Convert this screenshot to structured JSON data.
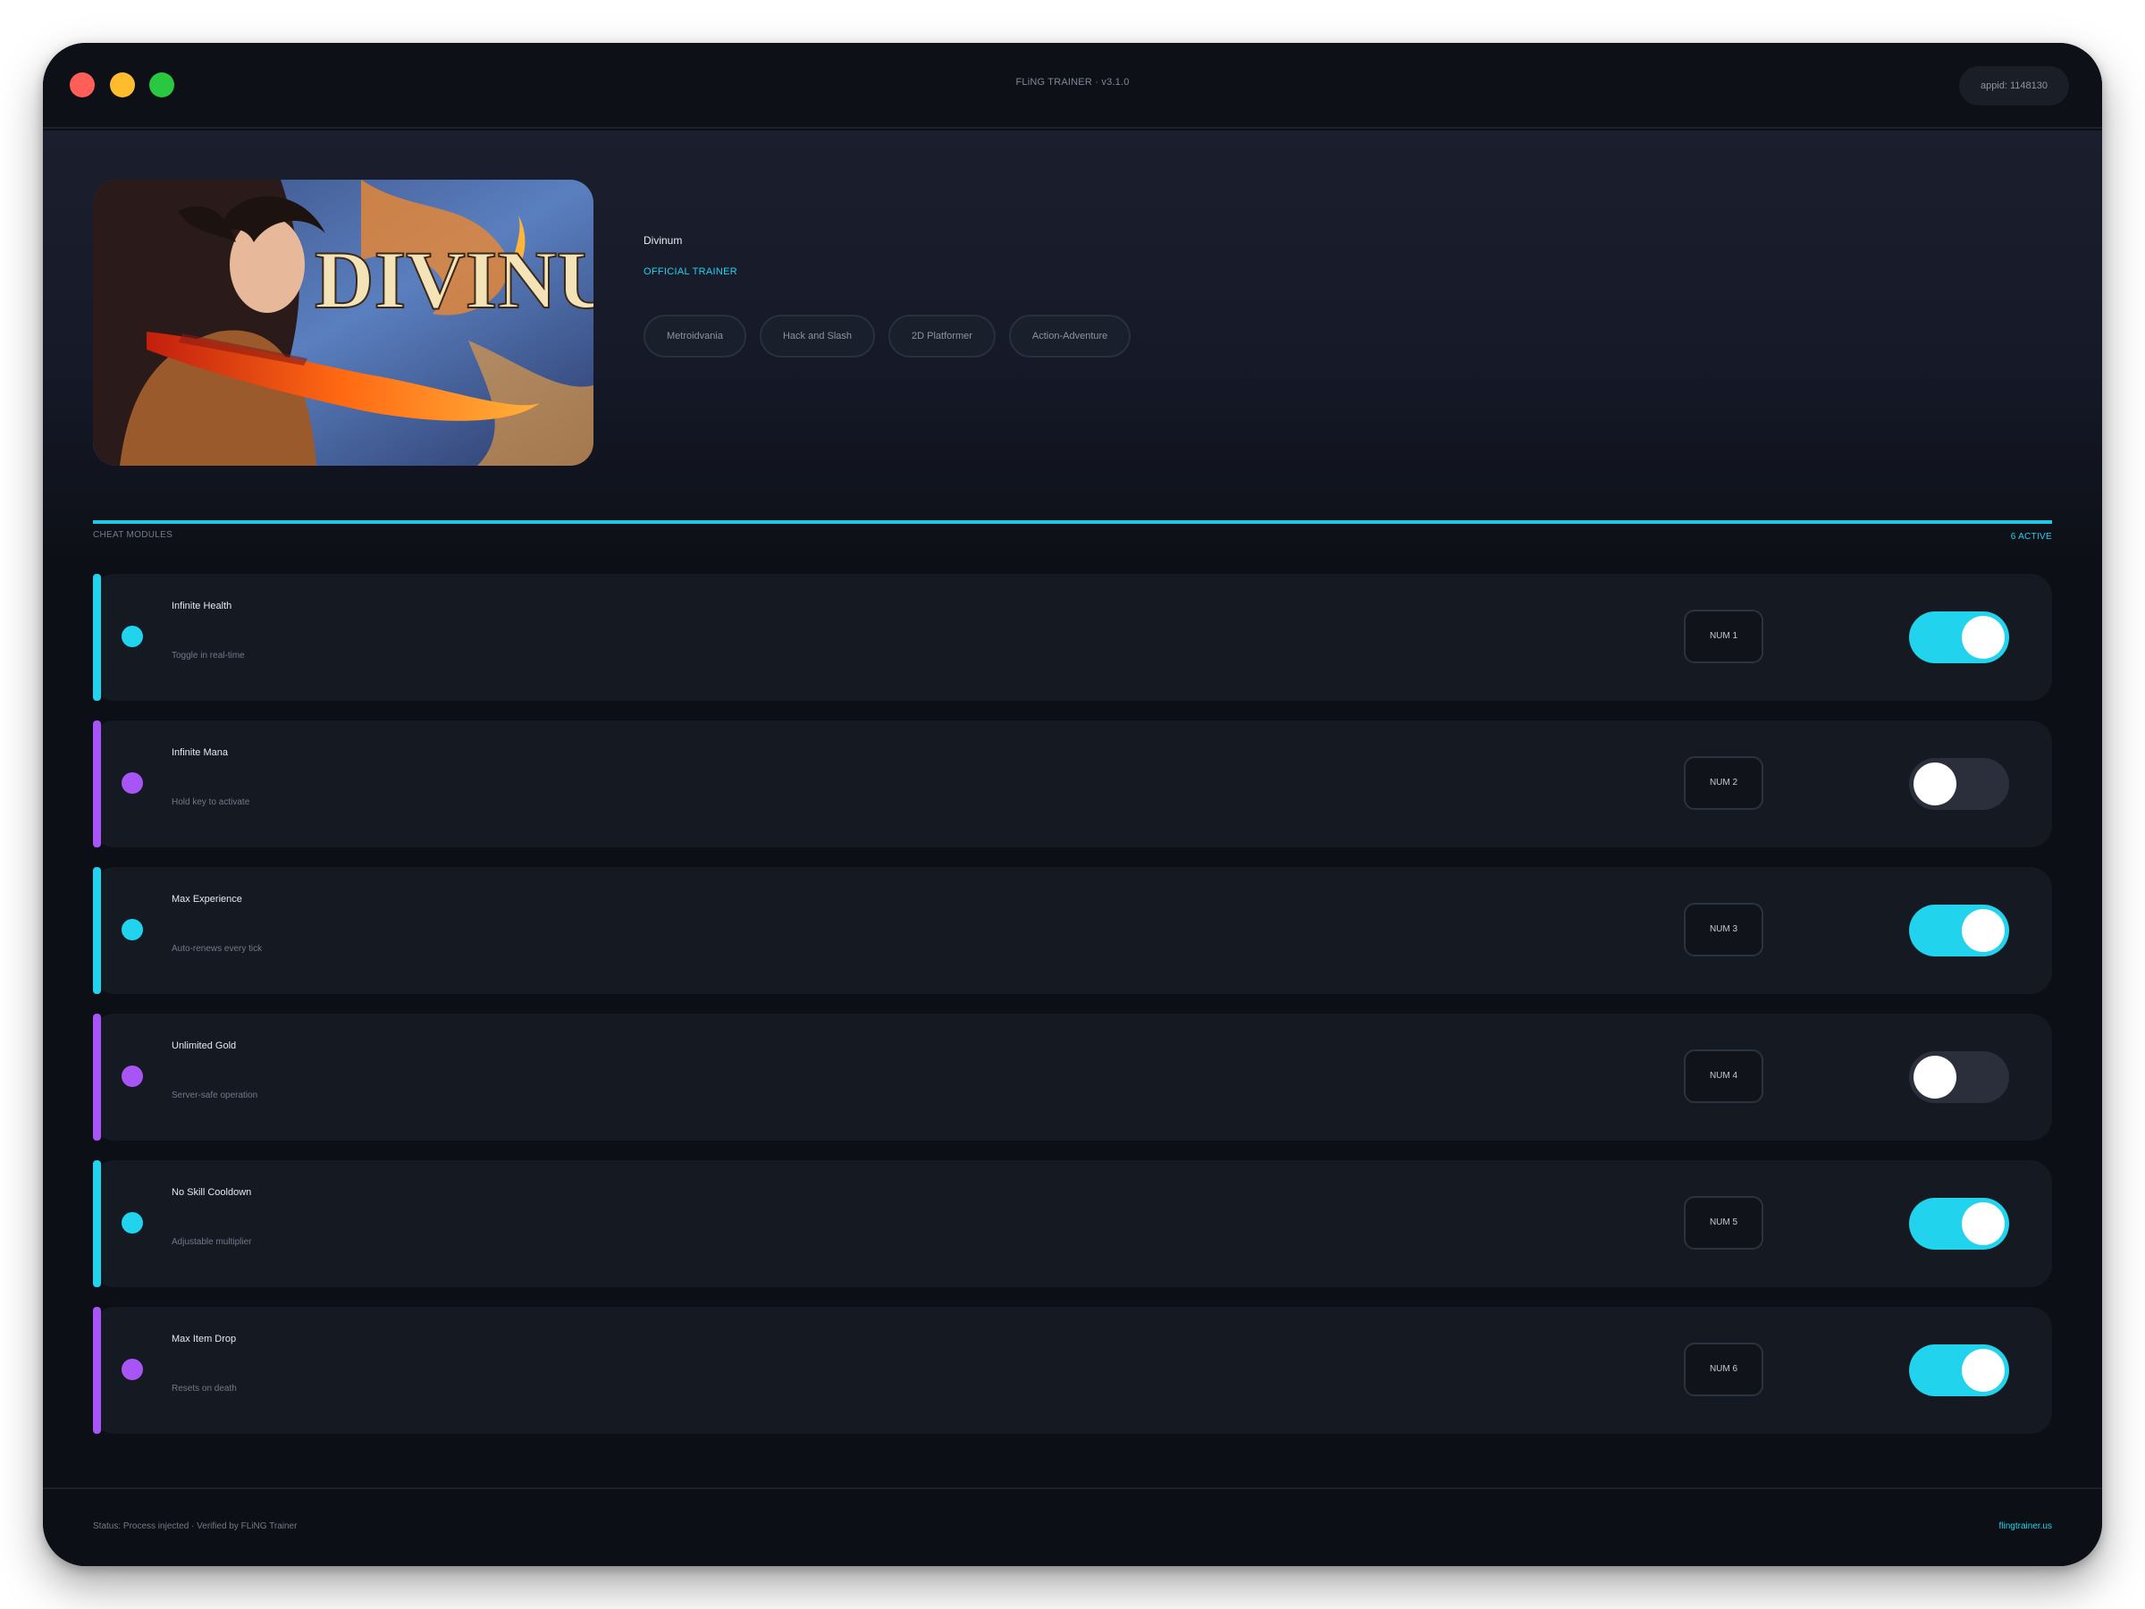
{
  "window": {
    "title": "FLiNG TRAINER · v3.1.0",
    "appid_label": "appid: 1148130"
  },
  "game": {
    "title": "Divinum",
    "badge": "OFFICIAL TRAINER",
    "cover_logo_text": "DIVINUM",
    "tags": [
      "Metroidvania",
      "Hack and Slash",
      "2D Platformer",
      "Action-Adventure"
    ]
  },
  "modules_section": {
    "label": "CHEAT MODULES",
    "active_count": "6 ACTIVE"
  },
  "colors": {
    "accent_cyan": "#22d3ee",
    "accent_purple": "#a855f7",
    "toggle_off": "#2b2f3b",
    "background": "#0c0f15"
  },
  "cheats": [
    {
      "name": "Infinite Health",
      "description": "Toggle in real-time",
      "hotkey": "NUM 1",
      "enabled": true,
      "accent": "#22d3ee"
    },
    {
      "name": "Infinite Mana",
      "description": "Hold key to activate",
      "hotkey": "NUM 2",
      "enabled": false,
      "accent": "#a855f7"
    },
    {
      "name": "Max Experience",
      "description": "Auto-renews every tick",
      "hotkey": "NUM 3",
      "enabled": true,
      "accent": "#22d3ee"
    },
    {
      "name": "Unlimited Gold",
      "description": "Server-safe operation",
      "hotkey": "NUM 4",
      "enabled": false,
      "accent": "#a855f7"
    },
    {
      "name": "No Skill Cooldown",
      "description": "Adjustable multiplier",
      "hotkey": "NUM 5",
      "enabled": true,
      "accent": "#22d3ee"
    },
    {
      "name": "Max Item Drop",
      "description": "Resets on death",
      "hotkey": "NUM 6",
      "enabled": true,
      "accent": "#a855f7"
    }
  ],
  "footer": {
    "status": "Status: Process injected · Verified by FLiNG Trainer",
    "link": "flingtrainer.us"
  }
}
